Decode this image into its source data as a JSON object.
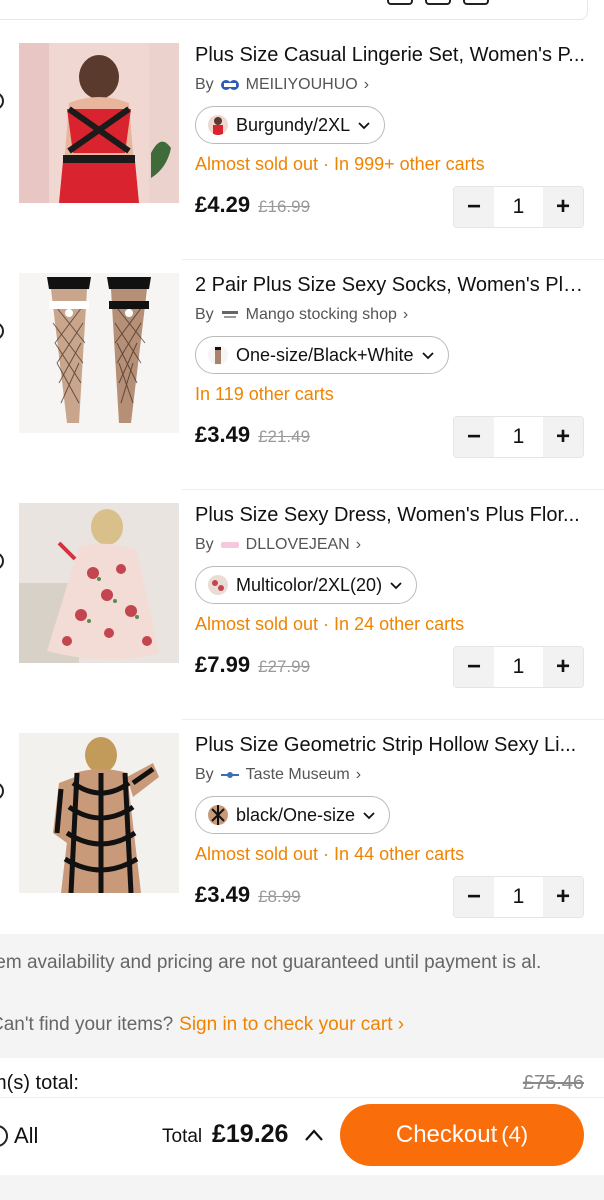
{
  "items": [
    {
      "title": "Plus Size Casual Lingerie Set, Women's P...",
      "store_prefix": "By",
      "store": "MEILIYOUHUO",
      "variant": "Burgundy/2XL",
      "status": "Almost sold out · In 999+ other carts",
      "price": "£4.29",
      "original_price": "£16.99",
      "quantity": "1"
    },
    {
      "title": "2 Pair Plus Size Sexy Socks, Women's Plu...",
      "store_prefix": "By",
      "store": "Mango stocking shop",
      "variant": "One-size/Black+White",
      "status": "In 119 other carts",
      "price": "£3.49",
      "original_price": "£21.49",
      "quantity": "1"
    },
    {
      "title": "Plus Size Sexy Dress, Women's Plus Flor...",
      "store_prefix": "By",
      "store": "DLLOVEJEAN",
      "variant": "Multicolor/2XL(20)",
      "status": "Almost sold out · In 24 other carts",
      "price": "£7.99",
      "original_price": "£27.99",
      "quantity": "1"
    },
    {
      "title": "Plus Size Geometric Strip Hollow Sexy Li...",
      "store_prefix": "By",
      "store": "Taste Museum",
      "variant": "black/One-size",
      "status": "Almost sold out · In 44 other carts",
      "price": "£3.49",
      "original_price": "£8.99",
      "quantity": "1"
    }
  ],
  "stepper": {
    "minus": "−",
    "plus": "+"
  },
  "notice": {
    "availability": "tem availability and pricing are not guaranteed until payment is al.",
    "cant_find": "Can't find your items?",
    "sign_in_link": "Sign in to check your cart ›"
  },
  "summary": {
    "items_total_label": "m(s) total:",
    "items_total_original": "£75.46"
  },
  "bottom_bar": {
    "select_all_label": "All",
    "total_label": "Total",
    "total_value": "£19.26",
    "checkout_label": "Checkout",
    "checkout_count": "(4)"
  },
  "colors": {
    "accent": "#fa6d0b",
    "status_orange": "#f08300",
    "muted": "#999999"
  },
  "icons": {
    "store_chevron": "chevron-right-icon",
    "variant_chevron": "chevron-down-icon",
    "total_caret": "chevron-up-icon"
  }
}
